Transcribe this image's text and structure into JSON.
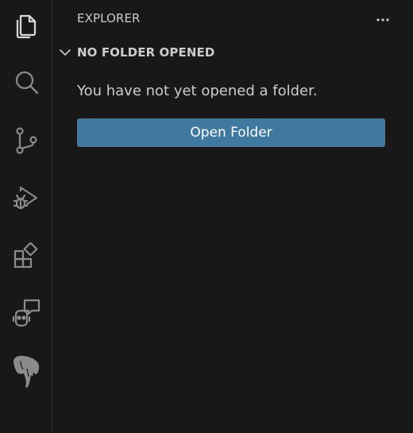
{
  "activity_bar": {
    "items": [
      {
        "icon": "explorer-files-icon",
        "active": true
      },
      {
        "icon": "search-icon",
        "active": false
      },
      {
        "icon": "source-control-icon",
        "active": false
      },
      {
        "icon": "run-debug-icon",
        "active": false
      },
      {
        "icon": "extensions-icon",
        "active": false
      },
      {
        "icon": "chat-copilot-icon",
        "active": false
      },
      {
        "icon": "elephant-extension-icon",
        "active": false
      }
    ]
  },
  "sidebar": {
    "title": "EXPLORER",
    "more_actions_icon": "ellipsis-icon",
    "section": {
      "title": "NO FOLDER OPENED",
      "expanded": true,
      "message": "You have not yet opened a folder.",
      "button_label": "Open Folder"
    }
  },
  "colors": {
    "background": "#181818",
    "text": "#cccccc",
    "icon": "#8b8b8b",
    "icon_active": "#d7d7d7",
    "button": "#3f79a0",
    "button_text": "#ffffff"
  }
}
